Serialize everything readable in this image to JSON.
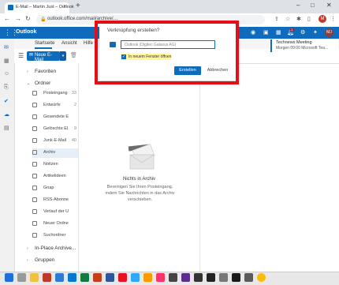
{
  "browser": {
    "tab_title": "E-Mail – Martin Just – Outlook",
    "new_tab_symbol": "+",
    "url": "outlook.office.com/mail/archive/…",
    "window_buttons": [
      "–",
      "□",
      "✕"
    ]
  },
  "outlook": {
    "app_title": "Outlook",
    "notification_badge": "1",
    "user_initials": "MJ",
    "ribbon_tabs": [
      "Startseite",
      "Ansicht",
      "Hilfe"
    ],
    "new_mail_label": "Neue E-Mail",
    "meeting": {
      "title": "Technews Meeting",
      "time": "Morgen 09:00 Microsoft Tea..."
    },
    "folder_groups": {
      "favorites": "Favoriten",
      "folders": "Ordner",
      "in_place": "In-Place Archive...",
      "groups": "Gruppen"
    },
    "folders": [
      {
        "label": "Posteingang",
        "count": "33"
      },
      {
        "label": "Entwürfe",
        "count": "2"
      },
      {
        "label": "Gesendete Ele...",
        "count": ""
      },
      {
        "label": "Gelöschte El...",
        "count": "9"
      },
      {
        "label": "Junk-E-Mail",
        "count": "40"
      },
      {
        "label": "Archiv",
        "count": ""
      },
      {
        "label": "Notizen",
        "count": ""
      },
      {
        "label": "Artikelideen",
        "count": ""
      },
      {
        "label": "Gnap",
        "count": ""
      },
      {
        "label": "RSS-Abonnem...",
        "count": ""
      },
      {
        "label": "Verlauf der Un...",
        "count": ""
      },
      {
        "label": "Neuer Ordner ...",
        "count": ""
      },
      {
        "label": "Suchordner",
        "count": ""
      }
    ],
    "empty_state": {
      "title": "Nichts in Archiv",
      "subtitle": "Bereinigen Sie Ihren Posteingang, indem Sie Nachrichten in das Archiv verschieben."
    }
  },
  "dialog": {
    "title": "Verknüpfung erstellen?",
    "name_value": "Outlook (Digitec Galaxus AG)",
    "checkbox_label": "In neuem Fenster öffnen",
    "checkbox_checked": true,
    "create_label": "Erstellen",
    "cancel_label": "Abbrechen"
  },
  "colors": {
    "accent": "#0f6cbd",
    "highlight_frame": "#e30e16"
  }
}
